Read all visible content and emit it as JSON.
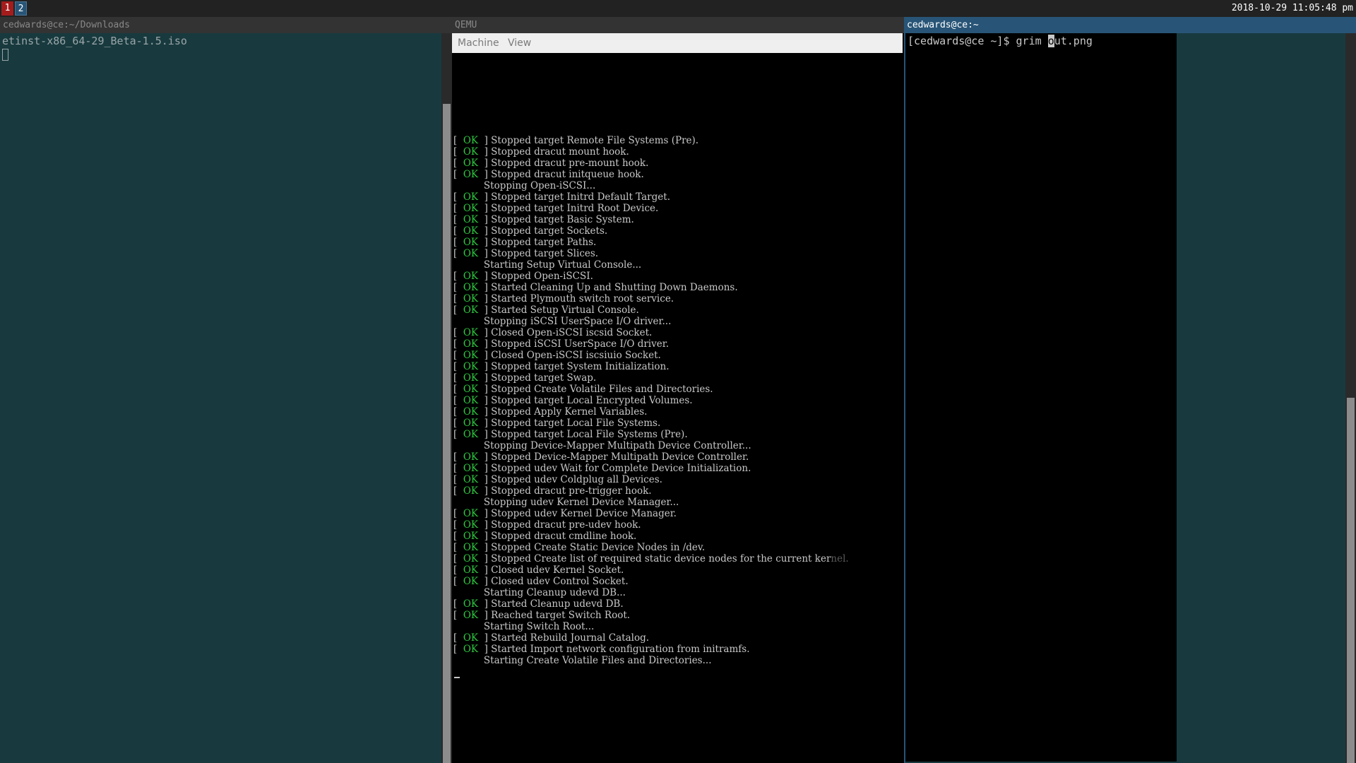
{
  "bar": {
    "workspaces": [
      {
        "label": "1",
        "state": "urgent"
      },
      {
        "label": "2",
        "state": "focused"
      }
    ],
    "clock": "2018-10-29 11:05:48 pm"
  },
  "windows": {
    "left": {
      "title": "cedwards@ce:~/Downloads",
      "line": "etinst-x86_64-29_Beta-1.5.iso"
    },
    "qemu": {
      "title": "QEMU",
      "menu": [
        "Machine",
        "View"
      ],
      "console_lines": [
        {
          "ok": true,
          "text": "Stopped target Remote File Systems (Pre)."
        },
        {
          "ok": true,
          "text": "Stopped dracut mount hook."
        },
        {
          "ok": true,
          "text": "Stopped dracut pre-mount hook."
        },
        {
          "ok": true,
          "text": "Stopped dracut initqueue hook."
        },
        {
          "ok": false,
          "text": "Stopping Open-iSCSI..."
        },
        {
          "ok": true,
          "text": "Stopped target Initrd Default Target."
        },
        {
          "ok": true,
          "text": "Stopped target Initrd Root Device."
        },
        {
          "ok": true,
          "text": "Stopped target Basic System."
        },
        {
          "ok": true,
          "text": "Stopped target Sockets."
        },
        {
          "ok": true,
          "text": "Stopped target Paths."
        },
        {
          "ok": true,
          "text": "Stopped target Slices."
        },
        {
          "ok": false,
          "text": "Starting Setup Virtual Console..."
        },
        {
          "ok": true,
          "text": "Stopped Open-iSCSI."
        },
        {
          "ok": true,
          "text": "Started Cleaning Up and Shutting Down Daemons."
        },
        {
          "ok": true,
          "text": "Started Plymouth switch root service."
        },
        {
          "ok": true,
          "text": "Started Setup Virtual Console."
        },
        {
          "ok": false,
          "text": "Stopping iSCSI UserSpace I/O driver..."
        },
        {
          "ok": true,
          "text": "Closed Open-iSCSI iscsid Socket."
        },
        {
          "ok": true,
          "text": "Stopped iSCSI UserSpace I/O driver."
        },
        {
          "ok": true,
          "text": "Closed Open-iSCSI iscsiuio Socket."
        },
        {
          "ok": true,
          "text": "Stopped target System Initialization."
        },
        {
          "ok": true,
          "text": "Stopped target Swap."
        },
        {
          "ok": true,
          "text": "Stopped Create Volatile Files and Directories."
        },
        {
          "ok": true,
          "text": "Stopped target Local Encrypted Volumes."
        },
        {
          "ok": true,
          "text": "Stopped Apply Kernel Variables."
        },
        {
          "ok": true,
          "text": "Stopped target Local File Systems."
        },
        {
          "ok": true,
          "text": "Stopped target Local File Systems (Pre)."
        },
        {
          "ok": false,
          "text": "Stopping Device-Mapper Multipath Device Controller..."
        },
        {
          "ok": true,
          "text": "Stopped Device-Mapper Multipath Device Controller."
        },
        {
          "ok": true,
          "text": "Stopped udev Wait for Complete Device Initialization."
        },
        {
          "ok": true,
          "text": "Stopped udev Coldplug all Devices."
        },
        {
          "ok": true,
          "text": "Stopped dracut pre-trigger hook."
        },
        {
          "ok": false,
          "text": "Stopping udev Kernel Device Manager..."
        },
        {
          "ok": true,
          "text": "Stopped udev Kernel Device Manager."
        },
        {
          "ok": true,
          "text": "Stopped dracut pre-udev hook."
        },
        {
          "ok": true,
          "text": "Stopped dracut cmdline hook."
        },
        {
          "ok": true,
          "text": "Stopped Create Static Device Nodes in /dev."
        },
        {
          "ok": true,
          "text": "Stopped Create list of required static device nodes for the current ker",
          "tail": "nel."
        },
        {
          "ok": true,
          "text": "Closed udev Kernel Socket."
        },
        {
          "ok": true,
          "text": "Closed udev Control Socket."
        },
        {
          "ok": false,
          "text": "Starting Cleanup udevd DB..."
        },
        {
          "ok": true,
          "text": "Started Cleanup udevd DB."
        },
        {
          "ok": true,
          "text": "Reached target Switch Root."
        },
        {
          "ok": false,
          "text": "Starting Switch Root..."
        },
        {
          "ok": true,
          "text": "Started Rebuild Journal Catalog."
        },
        {
          "ok": true,
          "text": "Started Import network configuration from initramfs."
        },
        {
          "ok": false,
          "text": "Starting Create Volatile Files and Directories..."
        }
      ]
    },
    "right": {
      "title": "cedwards@ce:~",
      "prompt": "[cedwards@ce ~]$ grim ",
      "cursor_char": "o",
      "after_cursor": "ut.png"
    }
  },
  "colors": {
    "ok": "#2ecc40",
    "urgent": "#a51c1c",
    "focused": "#285577",
    "terminal_bg": "#183a3f"
  }
}
